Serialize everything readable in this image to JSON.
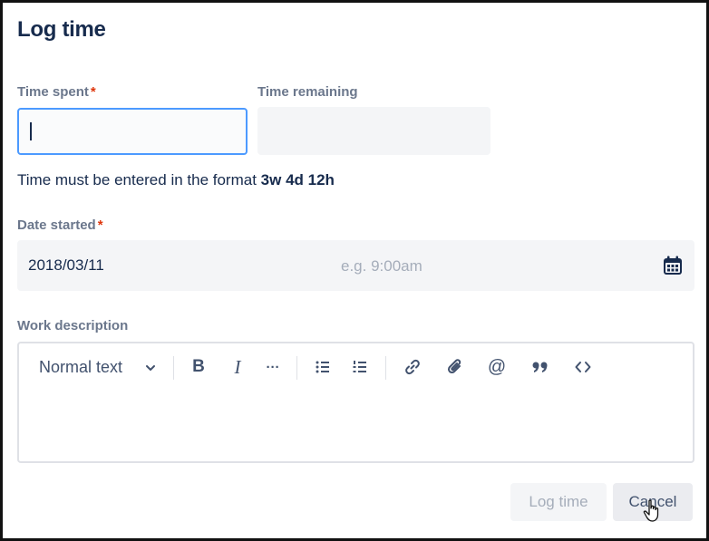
{
  "dialog": {
    "title": "Log time"
  },
  "time_spent": {
    "label": "Time spent",
    "required_mark": "*",
    "value": ""
  },
  "time_remaining": {
    "label": "Time remaining",
    "value": ""
  },
  "hint": {
    "prefix": "Time must be entered in the format",
    "format": "3w 4d 12h"
  },
  "date_started": {
    "label": "Date started",
    "required_mark": "*",
    "date_value": "2018/03/11",
    "time_placeholder": "e.g. 9:00am",
    "icon": "calendar-icon"
  },
  "work_description": {
    "label": "Work description",
    "toolbar": {
      "text_style": "Normal text",
      "bold": "B",
      "italic": "I",
      "more": "···",
      "icons": [
        "bold-icon",
        "italic-icon",
        "more-icon",
        "bullet-list-icon",
        "numbered-list-icon",
        "link-icon",
        "attachment-icon",
        "mention-icon",
        "quote-icon",
        "code-icon"
      ]
    }
  },
  "footer": {
    "log_time_label": "Log time",
    "cancel_label": "Cancel"
  },
  "colors": {
    "focus_border": "#4c9aff",
    "required": "#de350b",
    "text": "#172b4d",
    "muted": "#6b778c"
  }
}
